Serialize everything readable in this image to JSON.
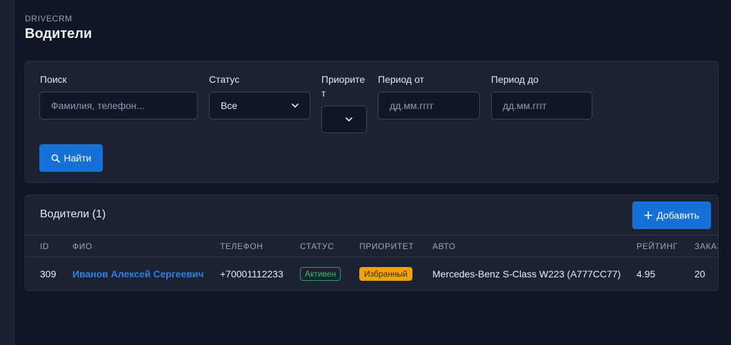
{
  "brand": "DRIVECRM",
  "page_title": "Водители",
  "filters": {
    "search_label": "Поиск",
    "search_placeholder": "Фамилия, телефон...",
    "status_label": "Статус",
    "status_value": "Все",
    "priority_label_line1": "Приорите",
    "priority_label_line2": "т",
    "priority_value": "",
    "period_from_label": "Период от",
    "period_from_placeholder": "дд.мм.гггг",
    "period_to_label": "Период до",
    "period_to_placeholder": "дд.мм.гггг",
    "find_button": "Найти"
  },
  "table": {
    "title": "Водители (1)",
    "add_button": "Добавить",
    "columns": [
      "ID",
      "ФИО",
      "ТЕЛЕФОН",
      "СТАТУС",
      "ПРИОРИТЕТ",
      "АВТО",
      "РЕЙТИНГ",
      "ЗАКАЗ"
    ],
    "rows": [
      {
        "id": "309",
        "name": "Иванов Алексей Сергеевич",
        "phone": "+70001112233",
        "status": "Активен",
        "priority": "Избранный",
        "car": "Mercedes-Benz S-Class W223 (А777СС77)",
        "rating": "4.95",
        "orders": "20"
      }
    ]
  },
  "colors": {
    "background": "#0f1626",
    "card": "#1b2333",
    "accent": "#1570d8",
    "link": "#2f7fe0",
    "status_active": "#3fb86a",
    "priority_badge": "#f2a20b"
  },
  "icons": {
    "search": "search-icon",
    "chevron": "chevron-down-icon",
    "plus": "plus-icon"
  }
}
